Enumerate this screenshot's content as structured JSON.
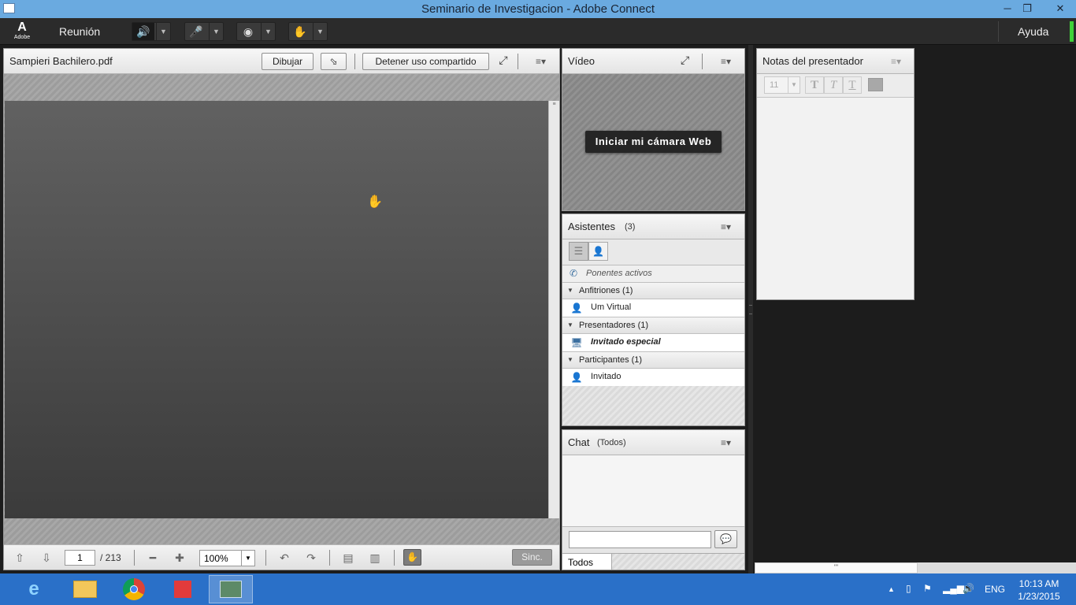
{
  "window": {
    "title": "Seminario de Investigacion - Adobe Connect",
    "controls": {
      "minimize": "─",
      "restore": "❐",
      "close": "✕"
    }
  },
  "menubar": {
    "logo_mark": "A",
    "logo_text": "Adobe",
    "meeting_menu": "Reunión",
    "help_menu": "Ayuda",
    "speaker_active_color": "#55dd22",
    "connection_color": "#3fd238"
  },
  "share_pod": {
    "title": "Sampieri Bachilero.pdf",
    "draw_button": "Dibujar",
    "stop_sharing_button": "Detener uso compartido",
    "page_current": "1",
    "page_total": "/ 213",
    "zoom": "100%",
    "sync_button": "Sinc."
  },
  "video_pod": {
    "title": "Vídeo",
    "start_webcam_button": "Iniciar mi cámara Web"
  },
  "attendees_pod": {
    "title": "Asistentes",
    "count": "(3)",
    "active_speakers": "Ponentes activos",
    "groups": [
      {
        "label": "Anfitriones (1)",
        "user": "Um Virtual",
        "user_icon": "host-icon"
      },
      {
        "label": "Presentadores (1)",
        "user": "Invitado especial",
        "user_icon": "presenter-icon"
      },
      {
        "label": "Participantes (1)",
        "user": "Invitado",
        "user_icon": "participant-icon"
      }
    ]
  },
  "chat_pod": {
    "title": "Chat",
    "scope": "(Todos)",
    "tab_all": "Todos"
  },
  "notes_pod": {
    "title": "Notas del presentador",
    "font_size": "11"
  },
  "taskbar": {
    "lang": "ENG",
    "time": "10:13 AM",
    "date": "1/23/2015"
  }
}
